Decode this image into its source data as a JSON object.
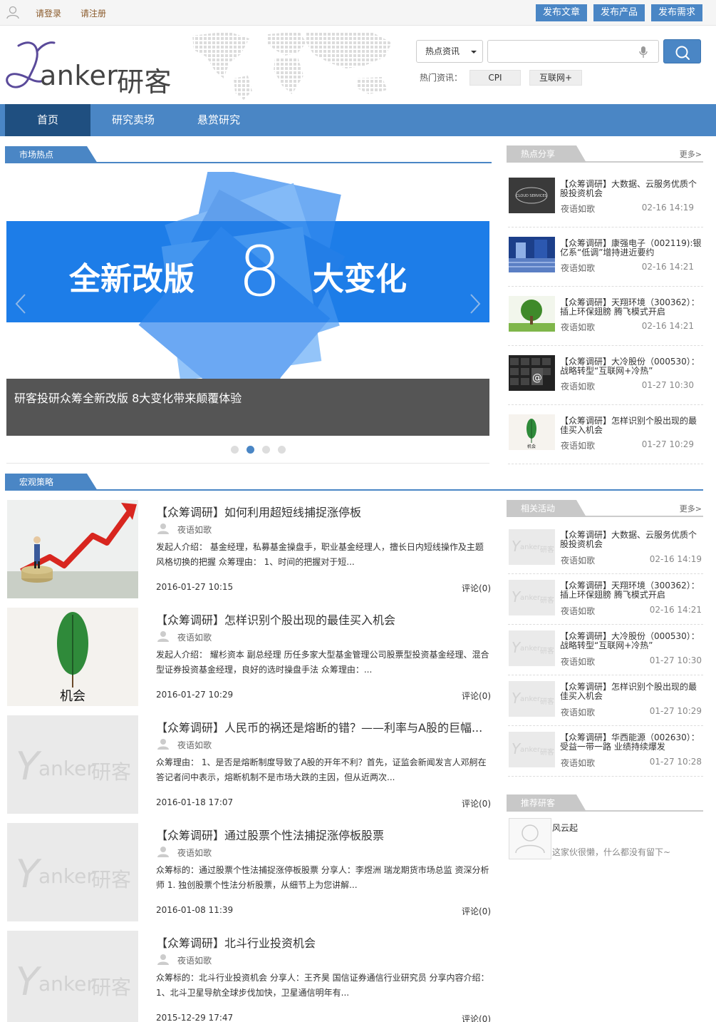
{
  "topbar": {
    "login": "请登录",
    "register": "请注册",
    "buttons": [
      "发布文章",
      "发布产品",
      "发布需求"
    ]
  },
  "header": {
    "logo_text": "anker",
    "logo_cn": "研客",
    "search_category": "热点资讯",
    "search_placeholder": "",
    "hot_label": "热门资讯：",
    "hot_tags": [
      "CPI",
      "互联网+"
    ]
  },
  "nav": [
    "首页",
    "研究卖场",
    "悬赏研究"
  ],
  "market_hot": {
    "title": "市场热点",
    "banner_left": "全新改版",
    "banner_num": "8",
    "banner_right": "大变化",
    "caption": "研客投研众筹全新改版 8大变化带来颠覆体验"
  },
  "hot_share": {
    "title": "热点分享",
    "more": "更多>",
    "items": [
      {
        "title": "【众筹调研】大数据、云服务优质个股投资机会",
        "author": "夜语如歌",
        "date": "02-16 14:19",
        "thumb_text": "CLOUD SERVICES"
      },
      {
        "title": "【众筹调研】康强电子（002119):银亿系“低调”增持进近要约",
        "author": "夜语如歌",
        "date": "02-16 14:21"
      },
      {
        "title": "【众筹调研】天翔环境（300362）：插上环保翅膀 腾飞模式开启",
        "author": "夜语如歌",
        "date": "02-16 14:21"
      },
      {
        "title": "【众筹调研】大冷股份（000530）：战略转型“互联网+冷热”",
        "author": "夜语如歌",
        "date": "01-27 10:30",
        "thumb_text": "@"
      },
      {
        "title": "【众筹调研】怎样识别个股出现的最佳买入机会",
        "author": "夜语如歌",
        "date": "01-27 10:29",
        "thumb_text": "机会"
      }
    ]
  },
  "macro": {
    "title": "宏观策略",
    "articles": [
      {
        "title": "【众筹调研】如何利用超短线捕捉涨停板",
        "author": "夜语如歌",
        "desc": "发起人介绍： 基金经理，私募基金操盘手，职业基金经理人，擅长日内短线操作及主题风格切换的把握 众筹理由： 1、时间的把握对于短...",
        "date": "2016-01-27 10:15",
        "comment": "评论(0)"
      },
      {
        "title": "【众筹调研】怎样识别个股出现的最佳买入机会",
        "author": "夜语如歌",
        "desc": "发起人介绍： 耀杉资本 副总经理 历任多家大型基金管理公司股票型投资基金经理、混合型证券投资基金经理，良好的选时操盘手法 众筹理由：...",
        "date": "2016-01-27 10:29",
        "comment": "评论(0)",
        "img_text": "机会"
      },
      {
        "title": "【众筹调研】人民币的祸还是熔断的错？——利率与A股的巨幅...",
        "author": "夜语如歌",
        "desc": "众筹理由： 1、是否是熔断制度导致了A股的开年不利？首先，证监会新闻发言人邓舸在答记者问中表示，熔断机制不是市场大跌的主因，但从近两次...",
        "date": "2016-01-18 17:07",
        "comment": "评论(0)"
      },
      {
        "title": "【众筹调研】通过股票个性法捕捉涨停板股票",
        "author": "夜语如歌",
        "desc": "众筹标的：通过股票个性法捕捉涨停板股票 分享人：李煜洲 瑞龙期货市场总监 资深分析师 1. 独创股票个性法分析股票，从细节上为您讲解...",
        "date": "2016-01-08 11:39",
        "comment": "评论(0)"
      },
      {
        "title": "【众筹调研】北斗行业投资机会",
        "author": "夜语如歌",
        "desc": "众筹标的：北斗行业投资机会 分享人：王齐昊 国信证券通信行业研究员 分享内容介绍：1、北斗卫星导航全球步伐加快，卫星通信明年有...",
        "date": "2015-12-29 17:47",
        "comment": "评论(0)"
      }
    ]
  },
  "related": {
    "title": "相关活动",
    "more": "更多>",
    "items": [
      {
        "title": "【众筹调研】大数据、云服务优质个股投资机会",
        "author": "夜语如歌",
        "date": "02-16 14:19"
      },
      {
        "title": "【众筹调研】天翔环境（300362）：插上环保翅膀 腾飞模式开启",
        "author": "夜语如歌",
        "date": "02-16 14:21"
      },
      {
        "title": "【众筹调研】大冷股份（000530）：战略转型“互联网+冷热”",
        "author": "夜语如歌",
        "date": "01-27 10:30"
      },
      {
        "title": "【众筹调研】怎样识别个股出现的最佳买入机会",
        "author": "夜语如歌",
        "date": "01-27 10:29"
      },
      {
        "title": "【众筹调研】华西能源（002630）：受益一带一路 业绩持续爆发",
        "author": "夜语如歌",
        "date": "01-27 10:28"
      }
    ]
  },
  "recommend": {
    "title": "推荐研客",
    "name": "风云起",
    "desc": "这家伙很懒，什么都没有留下~"
  },
  "colors": {
    "brand": "#4a86c5",
    "nav_active": "#1f4f80",
    "banner_blue": "#1e7de8"
  }
}
